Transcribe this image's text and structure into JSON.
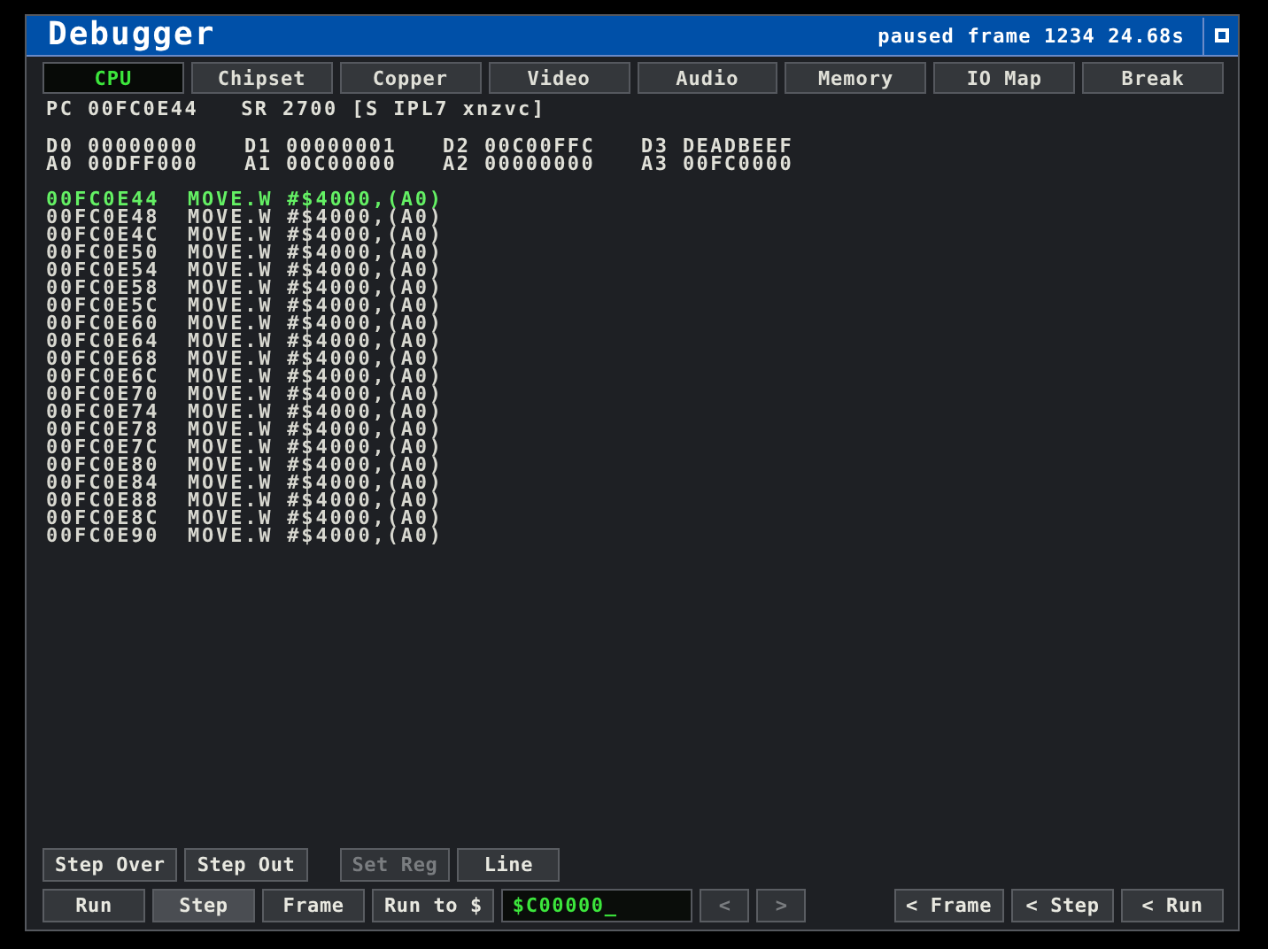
{
  "window": {
    "title": "Debugger",
    "status": "paused frame 1234 24.68s"
  },
  "tabs": [
    {
      "label": "CPU",
      "selected": true
    },
    {
      "label": "Chipset",
      "selected": false
    },
    {
      "label": "Copper",
      "selected": false
    },
    {
      "label": "Video",
      "selected": false
    },
    {
      "label": "Audio",
      "selected": false
    },
    {
      "label": "Memory",
      "selected": false
    },
    {
      "label": "IO Map",
      "selected": false
    },
    {
      "label": "Break",
      "selected": false
    }
  ],
  "status_line": [
    "PC 00FC0E44",
    "SR 2700 [S IPL7 xnzvc]"
  ],
  "registers": [
    {
      "name": "D0",
      "value": "00000000"
    },
    {
      "name": "D1",
      "value": "00000001"
    },
    {
      "name": "D2",
      "value": "00C00FFC"
    },
    {
      "name": "D3",
      "value": "DEADBEEF"
    },
    {
      "name": "A0",
      "value": "00DFF000"
    },
    {
      "name": "A1",
      "value": "00C00000"
    },
    {
      "name": "A2",
      "value": "00000000"
    },
    {
      "name": "A3",
      "value": "00FC0000"
    }
  ],
  "disassembly": [
    {
      "address": "00FC0E44",
      "instruction": "MOVE.W #$4000,(A0)",
      "current": true
    },
    {
      "address": "00FC0E48",
      "instruction": "MOVE.W #$4000,(A0)",
      "current": false
    },
    {
      "address": "00FC0E4C",
      "instruction": "MOVE.W #$4000,(A0)",
      "current": false
    },
    {
      "address": "00FC0E50",
      "instruction": "MOVE.W #$4000,(A0)",
      "current": false
    },
    {
      "address": "00FC0E54",
      "instruction": "MOVE.W #$4000,(A0)",
      "current": false
    },
    {
      "address": "00FC0E58",
      "instruction": "MOVE.W #$4000,(A0)",
      "current": false
    },
    {
      "address": "00FC0E5C",
      "instruction": "MOVE.W #$4000,(A0)",
      "current": false
    },
    {
      "address": "00FC0E60",
      "instruction": "MOVE.W #$4000,(A0)",
      "current": false
    },
    {
      "address": "00FC0E64",
      "instruction": "MOVE.W #$4000,(A0)",
      "current": false
    },
    {
      "address": "00FC0E68",
      "instruction": "MOVE.W #$4000,(A0)",
      "current": false
    },
    {
      "address": "00FC0E6C",
      "instruction": "MOVE.W #$4000,(A0)",
      "current": false
    },
    {
      "address": "00FC0E70",
      "instruction": "MOVE.W #$4000,(A0)",
      "current": false
    },
    {
      "address": "00FC0E74",
      "instruction": "MOVE.W #$4000,(A0)",
      "current": false
    },
    {
      "address": "00FC0E78",
      "instruction": "MOVE.W #$4000,(A0)",
      "current": false
    },
    {
      "address": "00FC0E7C",
      "instruction": "MOVE.W #$4000,(A0)",
      "current": false
    },
    {
      "address": "00FC0E80",
      "instruction": "MOVE.W #$4000,(A0)",
      "current": false
    },
    {
      "address": "00FC0E84",
      "instruction": "MOVE.W #$4000,(A0)",
      "current": false
    },
    {
      "address": "00FC0E88",
      "instruction": "MOVE.W #$4000,(A0)",
      "current": false
    },
    {
      "address": "00FC0E8C",
      "instruction": "MOVE.W #$4000,(A0)",
      "current": false
    },
    {
      "address": "00FC0E90",
      "instruction": "MOVE.W #$4000,(A0)",
      "current": false
    }
  ],
  "toolbar_1": [
    {
      "kind": "button",
      "label": "Step Over",
      "disabled": false,
      "selected": false
    },
    {
      "kind": "button",
      "label": "Step Out",
      "disabled": false,
      "selected": false
    },
    {
      "kind": "spacer"
    },
    {
      "kind": "button",
      "label": "Set Reg",
      "disabled": true,
      "selected": false
    },
    {
      "kind": "button",
      "label": "Line",
      "disabled": false,
      "selected": false
    }
  ],
  "toolbar_2": [
    {
      "kind": "button",
      "label": "Run",
      "disabled": false,
      "selected": false
    },
    {
      "kind": "button",
      "label": "Step",
      "disabled": false,
      "selected": true
    },
    {
      "kind": "button",
      "label": "Frame",
      "disabled": false,
      "selected": false
    },
    {
      "kind": "button",
      "label": "Run to $",
      "disabled": false,
      "selected": false
    },
    {
      "kind": "input",
      "value": "$C00000_"
    },
    {
      "kind": "button",
      "label": "<",
      "disabled": true,
      "selected": false
    },
    {
      "kind": "button",
      "label": ">",
      "disabled": true,
      "selected": false
    },
    {
      "kind": "spacer"
    },
    {
      "kind": "button",
      "label": "< Frame",
      "disabled": false,
      "selected": false
    },
    {
      "kind": "button",
      "label": "< Step",
      "disabled": false,
      "selected": false
    },
    {
      "kind": "button",
      "label": "< Run",
      "disabled": false,
      "selected": false
    }
  ]
}
